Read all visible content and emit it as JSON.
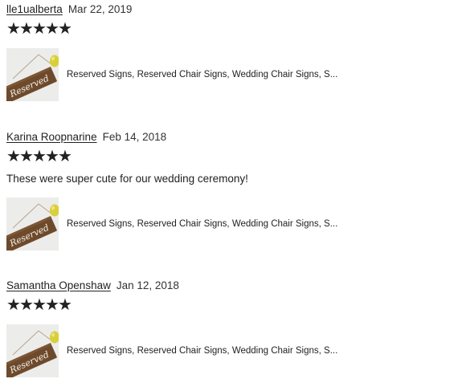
{
  "reviews": [
    {
      "reviewer": "lle1ualberta",
      "date": "Mar 22, 2019",
      "rating": 5,
      "text": "",
      "item_title": "Reserved Signs, Reserved Chair Signs, Wedding Chair Signs, S...",
      "thumbnail_sign_text": "Reserved"
    },
    {
      "reviewer": "Karina Roopnarine",
      "date": "Feb 14, 2018",
      "rating": 5,
      "text": "These were super cute for our wedding ceremony!",
      "item_title": "Reserved Signs, Reserved Chair Signs, Wedding Chair Signs, S...",
      "thumbnail_sign_text": "Reserved"
    },
    {
      "reviewer": "Samantha Openshaw",
      "date": "Jan 12, 2018",
      "rating": 5,
      "text": "",
      "item_title": "Reserved Signs, Reserved Chair Signs, Wedding Chair Signs, S...",
      "thumbnail_sign_text": "Reserved"
    }
  ],
  "colors": {
    "text": "#222222",
    "star": "#222222",
    "thumb_bg": "#ececeb",
    "sign_wood": "#6e4a2c",
    "lemon": "#d9cf3a"
  },
  "icons": {
    "star": "star-icon"
  }
}
